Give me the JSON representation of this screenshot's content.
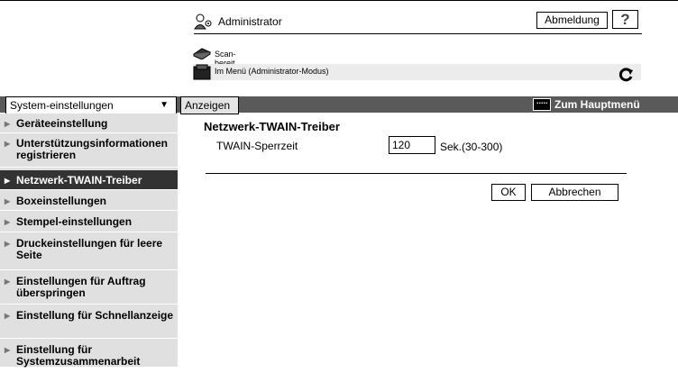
{
  "header": {
    "user_label": "Administrator",
    "logout_label": "Abmeldung",
    "help_label": "?",
    "status_scan": "Scan-bereit",
    "status_menu": "Im Menü (Administrator-Modus)"
  },
  "navbar": {
    "select_value": "System-einstellungen",
    "show_label": "Anzeigen",
    "home_label": "Zum Hauptmenü"
  },
  "sidebar": {
    "items": [
      {
        "label": "Geräteeinstellung"
      },
      {
        "label": "Unterstützungsinformationen registrieren"
      },
      {
        "label": "Netzwerk-TWAIN-Treiber"
      },
      {
        "label": "Boxeinstellungen"
      },
      {
        "label": "Stempel-einstellungen"
      },
      {
        "label": "Druckeinstellungen für leere Seite"
      },
      {
        "label": "Einstellungen für Auftrag überspringen"
      },
      {
        "label": "Einstellung für Schnellanzeige"
      },
      {
        "label": "Einstellung für Systemzusammenarbeit"
      }
    ],
    "active_index": 2
  },
  "main": {
    "title": "Netzwerk-TWAIN-Treiber",
    "field_label": "TWAIN-Sperrzeit",
    "field_value": "120",
    "field_unit": "Sek.(30-300)",
    "ok_label": "OK",
    "cancel_label": "Abbrechen"
  }
}
